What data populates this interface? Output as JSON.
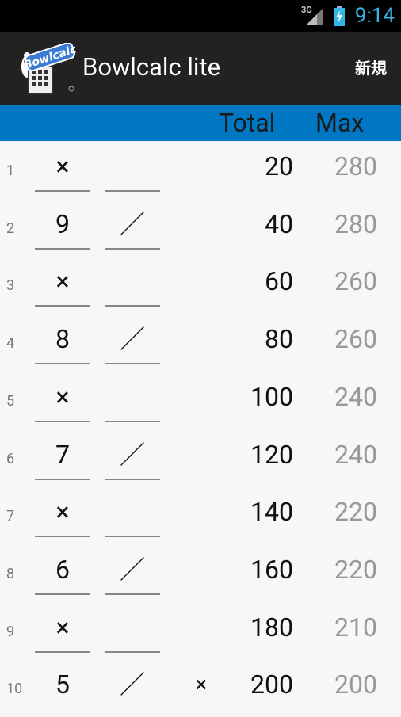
{
  "status": {
    "network_tag": "3G",
    "time": "9:14"
  },
  "app": {
    "title": "Bowlcalc lite",
    "new_label": "新規",
    "logo_text": "Bowlcalc"
  },
  "header": {
    "total": "Total",
    "max": "Max"
  },
  "frames": [
    {
      "num": "1",
      "b1": "×",
      "b2": "",
      "b3": "",
      "total": "20",
      "max": "280"
    },
    {
      "num": "2",
      "b1": "9",
      "b2": "／",
      "b3": "",
      "total": "40",
      "max": "280"
    },
    {
      "num": "3",
      "b1": "×",
      "b2": "",
      "b3": "",
      "total": "60",
      "max": "260"
    },
    {
      "num": "4",
      "b1": "8",
      "b2": "／",
      "b3": "",
      "total": "80",
      "max": "260"
    },
    {
      "num": "5",
      "b1": "×",
      "b2": "",
      "b3": "",
      "total": "100",
      "max": "240"
    },
    {
      "num": "6",
      "b1": "7",
      "b2": "／",
      "b3": "",
      "total": "120",
      "max": "240"
    },
    {
      "num": "7",
      "b1": "×",
      "b2": "",
      "b3": "",
      "total": "140",
      "max": "220"
    },
    {
      "num": "8",
      "b1": "6",
      "b2": "／",
      "b3": "",
      "total": "160",
      "max": "220"
    },
    {
      "num": "9",
      "b1": "×",
      "b2": "",
      "b3": "",
      "total": "180",
      "max": "210"
    },
    {
      "num": "10",
      "b1": "5",
      "b2": "／",
      "b3": "×",
      "total": "200",
      "max": "200"
    }
  ],
  "colors": {
    "status_accent": "#33b5e5",
    "header_bg": "#0077c2",
    "app_bar_bg": "#222222",
    "max_text": "#999999"
  }
}
